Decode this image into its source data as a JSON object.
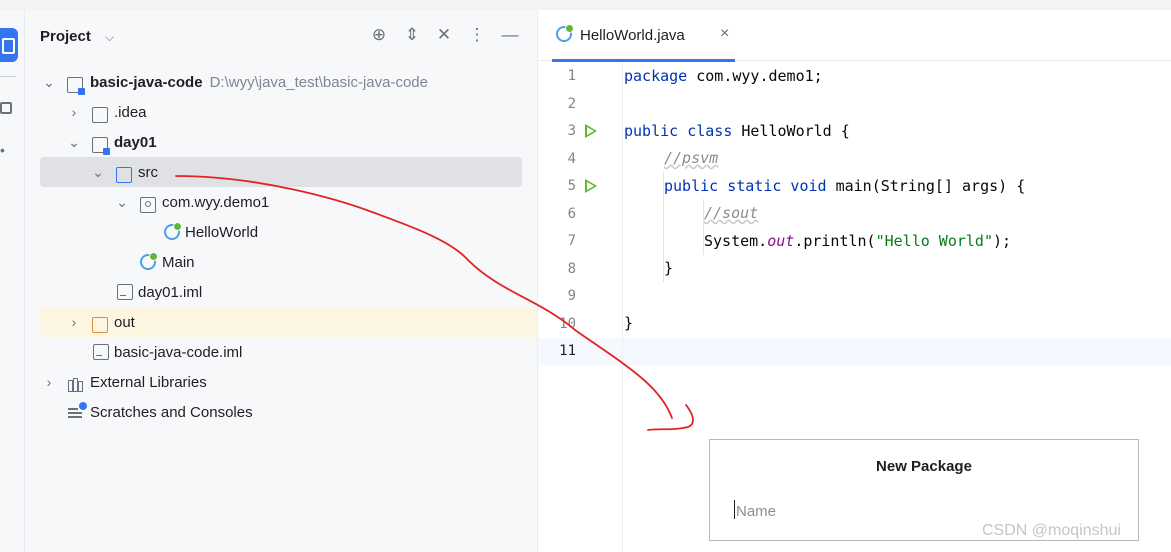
{
  "project_panel": {
    "title": "Project",
    "tree": [
      {
        "label": "basic-java-code",
        "path": "D:\\wyy\\java_test\\basic-java-code",
        "icon": "module-folder-icon",
        "bold": true
      },
      {
        "label": ".idea",
        "icon": "folder-icon"
      },
      {
        "label": "day01",
        "icon": "module-folder-icon",
        "bold": true
      },
      {
        "label": "src",
        "icon": "source-folder-icon",
        "selected": true
      },
      {
        "label": "com.wyy.demo1",
        "icon": "package-icon"
      },
      {
        "label": "HelloWorld",
        "icon": "java-class-icon"
      },
      {
        "label": "Main",
        "icon": "java-class-icon"
      },
      {
        "label": "day01.iml",
        "icon": "iml-file-icon"
      },
      {
        "label": "out",
        "icon": "excluded-folder-icon",
        "highlighted": true
      },
      {
        "label": "basic-java-code.iml",
        "icon": "iml-file-icon"
      },
      {
        "label": "External Libraries",
        "icon": "libraries-icon"
      },
      {
        "label": "Scratches and Consoles",
        "icon": "scratches-icon"
      }
    ]
  },
  "editor": {
    "tab_label": "HelloWorld.java",
    "line_numbers": [
      "1",
      "2",
      "3",
      "4",
      "5",
      "6",
      "7",
      "8",
      "9",
      "10",
      "11"
    ],
    "code": {
      "l1_kw": "package",
      "l1_rest": " com.wyy.demo1;",
      "l3_kw": "public class",
      "l3_rest": " HelloWorld {",
      "l4_comment": "//psvm",
      "l5_kw": "public static void",
      "l5_rest": " main(String[] args) {",
      "l6_comment": "//sout",
      "l7_a": "System.",
      "l7_field": "out",
      "l7_b": ".println(",
      "l7_str": "\"Hello World\"",
      "l7_c": ");",
      "l8": "}",
      "l10": "}"
    }
  },
  "dialog": {
    "title": "New Package",
    "input_placeholder": "Name",
    "input_value": ""
  },
  "watermark": "CSDN @moqinshui",
  "colors": {
    "accent": "#3574f0",
    "keyword": "#0033b3",
    "string": "#067d17",
    "annotation_stroke": "#e32222"
  }
}
